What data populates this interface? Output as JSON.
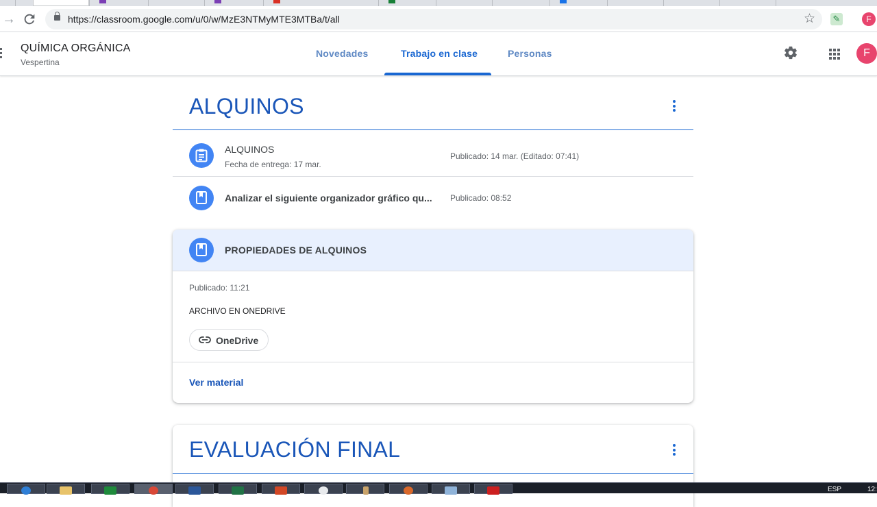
{
  "browser": {
    "url": "https://classroom.google.com/u/0/w/MzE3NTMyMTE3MTBa/t/all",
    "profile_initial": "F"
  },
  "header": {
    "class_name": "QUÍMICA ORGÁNICA",
    "section": "Vespertina",
    "tabs": [
      "Novedades",
      "Trabajo en clase",
      "Personas"
    ],
    "active_tab": "Trabajo en clase",
    "avatar_initial": "F"
  },
  "topics": [
    {
      "title": "ALQUINOS",
      "items": [
        {
          "title": "ALQUINOS",
          "due": "Fecha de entrega: 17 mar.",
          "meta": "Publicado: 14 mar. (Editado: 07:41)",
          "icon": "assignment-icon"
        },
        {
          "title": "Analizar el siguiente organizador gráfico qu...",
          "meta": "Publicado: 08:52",
          "icon": "material-icon"
        }
      ],
      "expanded_card": {
        "title": "PROPIEDADES DE ALQUINOS",
        "published": "Publicado: 11:21",
        "description": "ARCHIVO EN ONEDRIVE",
        "attachment_label": "OneDrive",
        "link_label": "Ver material",
        "icon": "material-icon"
      }
    },
    {
      "title": "EVALUACIÓN FINAL"
    }
  ],
  "taskbar": {
    "language": "ESP",
    "clock_partial": "12:"
  },
  "colors": {
    "accent": "#1967d2",
    "topic_title": "#1a56b8",
    "icon_circle": "#4285f4",
    "card_header": "#e8f0fe",
    "avatar": "#e8446d"
  }
}
